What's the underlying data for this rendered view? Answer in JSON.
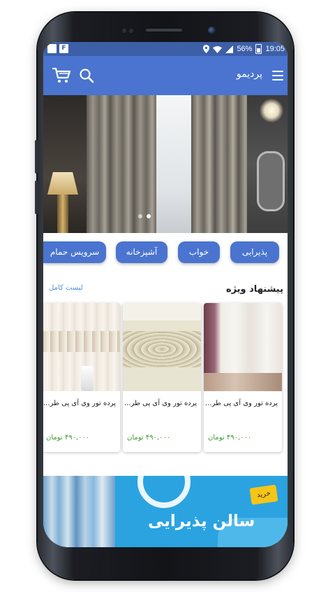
{
  "statusbar": {
    "battery_text": "56%",
    "time": "19:05",
    "left_box_label": "F"
  },
  "appbar": {
    "title": "پردیمو",
    "color": "#4a74cf",
    "icons": [
      "menu-icon",
      "search-icon",
      "cart-icon"
    ]
  },
  "hero": {
    "slide_count": 2,
    "active_slide": 2
  },
  "categories": [
    {
      "label": "پذیرایی"
    },
    {
      "label": "خواب"
    },
    {
      "label": "آشپزخانه"
    },
    {
      "label": "سرویس حمام"
    }
  ],
  "special_offers": {
    "title": "پیشنهاد ویژه",
    "see_all": "لیست کامل",
    "products": [
      {
        "name": "پرده تور وی آی پی طر...",
        "price": "۴۹۰,۰۰۰ تومان"
      },
      {
        "name": "پرده تور وی آی پی طر...",
        "price": "۴۹۰,۰۰۰ تومان"
      },
      {
        "name": "پرده تور وی آی پی طر...",
        "price": "۴۹۰,۰۰۰ تومان"
      }
    ]
  },
  "banner": {
    "badge": "خرید",
    "title": "سالن پذیرایی"
  },
  "colors": {
    "primary": "#4a74cf",
    "statusbar": "#3d5fa8",
    "price": "#3f9c35",
    "link": "#4a90d9",
    "banner_bg": "#2aa3e0",
    "badge": "#f5c518"
  }
}
